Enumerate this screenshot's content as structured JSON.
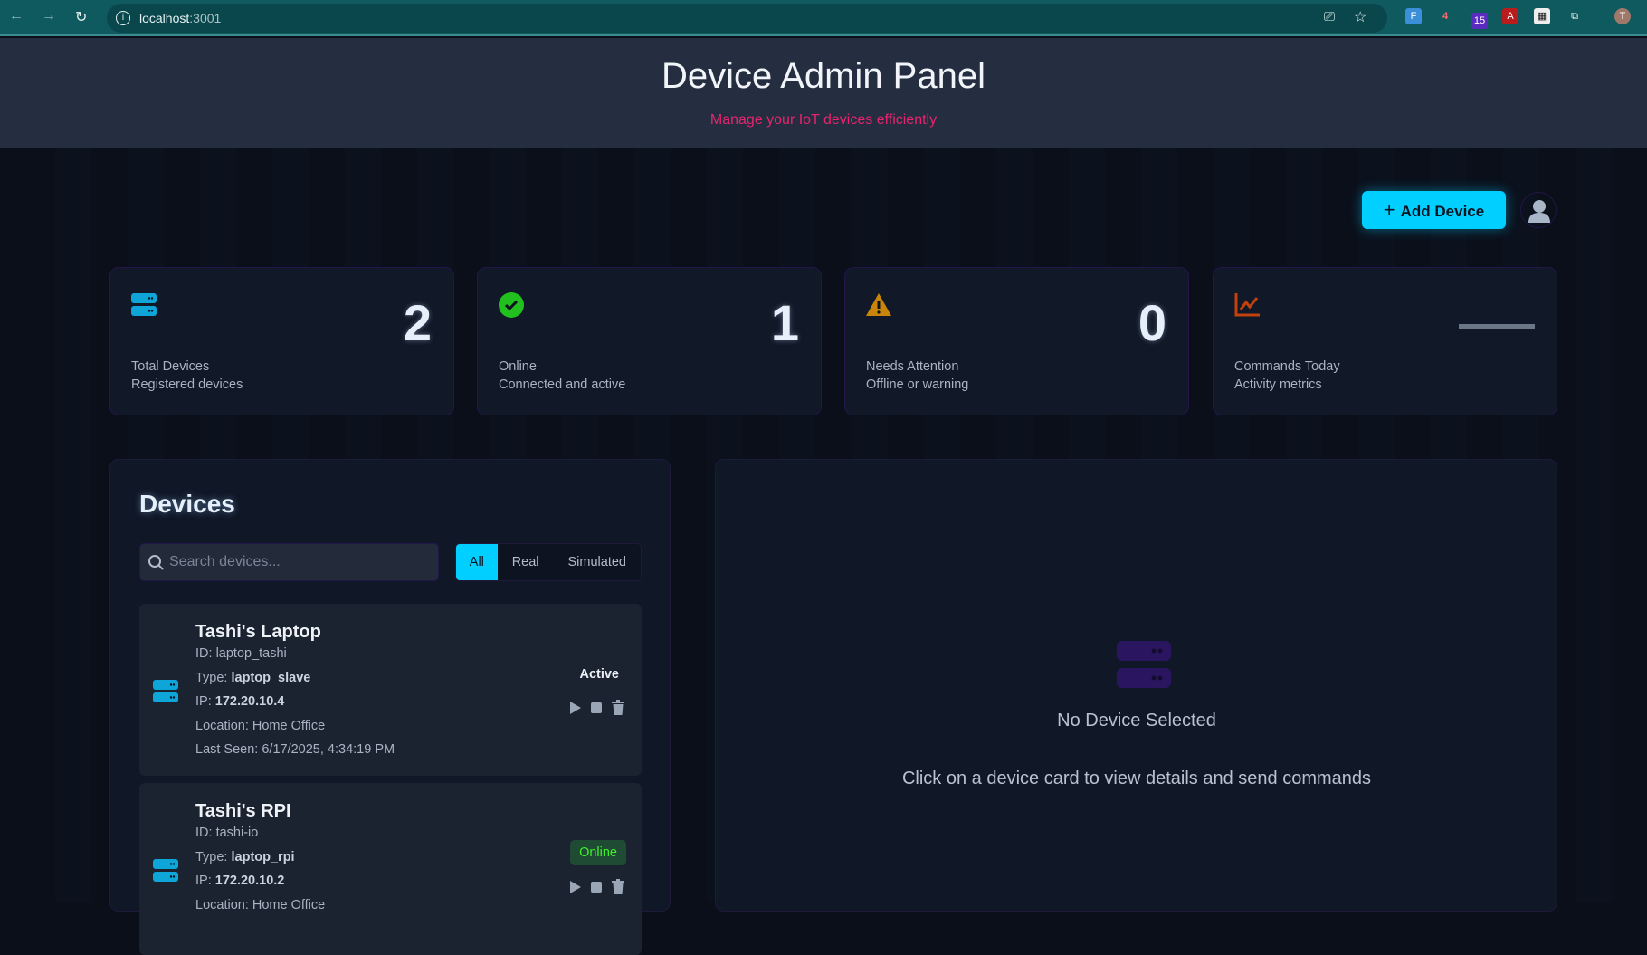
{
  "browser": {
    "url_host": "localhost",
    "url_port": ":3001",
    "ext_badges": [
      "4",
      "15"
    ],
    "profile_initial": "T"
  },
  "header": {
    "title": "Device Admin Panel",
    "subtitle": "Manage your IoT devices efficiently"
  },
  "toolbar": {
    "add_label": "Add Device"
  },
  "stats": [
    {
      "value": "2",
      "label": "Total Devices",
      "sub": "Registered devices",
      "icon": "server-icon",
      "color": "#0ea5d9"
    },
    {
      "value": "1",
      "label": "Online",
      "sub": "Connected and active",
      "icon": "check-circle-icon",
      "color": "#22c01e"
    },
    {
      "value": "0",
      "label": "Needs Attention",
      "sub": "Offline or warning",
      "icon": "warning-icon",
      "color": "#c8850a"
    },
    {
      "value": "—",
      "label": "Commands Today",
      "sub": "Activity metrics",
      "icon": "chart-line-icon",
      "color": "#c2410c"
    }
  ],
  "devices": {
    "title": "Devices",
    "search_placeholder": "Search devices...",
    "filters": [
      "All",
      "Real",
      "Simulated"
    ],
    "active_filter": "All",
    "items": [
      {
        "name": "Tashi's Laptop",
        "id_label": "ID: ",
        "id": "laptop_tashi",
        "type_label": "Type: ",
        "type": "laptop_slave",
        "ip_label": "IP: ",
        "ip": "172.20.10.4",
        "location": "Location: Home Office",
        "last_seen": "Last Seen: 6/17/2025, 4:34:19 PM",
        "status": "Active"
      },
      {
        "name": "Tashi's RPI",
        "id_label": "ID: ",
        "id": "tashi-io",
        "type_label": "Type: ",
        "type": "laptop_rpi",
        "ip_label": "IP: ",
        "ip": "172.20.10.2",
        "location": "Location: Home Office",
        "status": "Online"
      }
    ]
  },
  "detail": {
    "empty_title": "No Device Selected",
    "empty_text": "Click on a device card to view details and send commands"
  }
}
